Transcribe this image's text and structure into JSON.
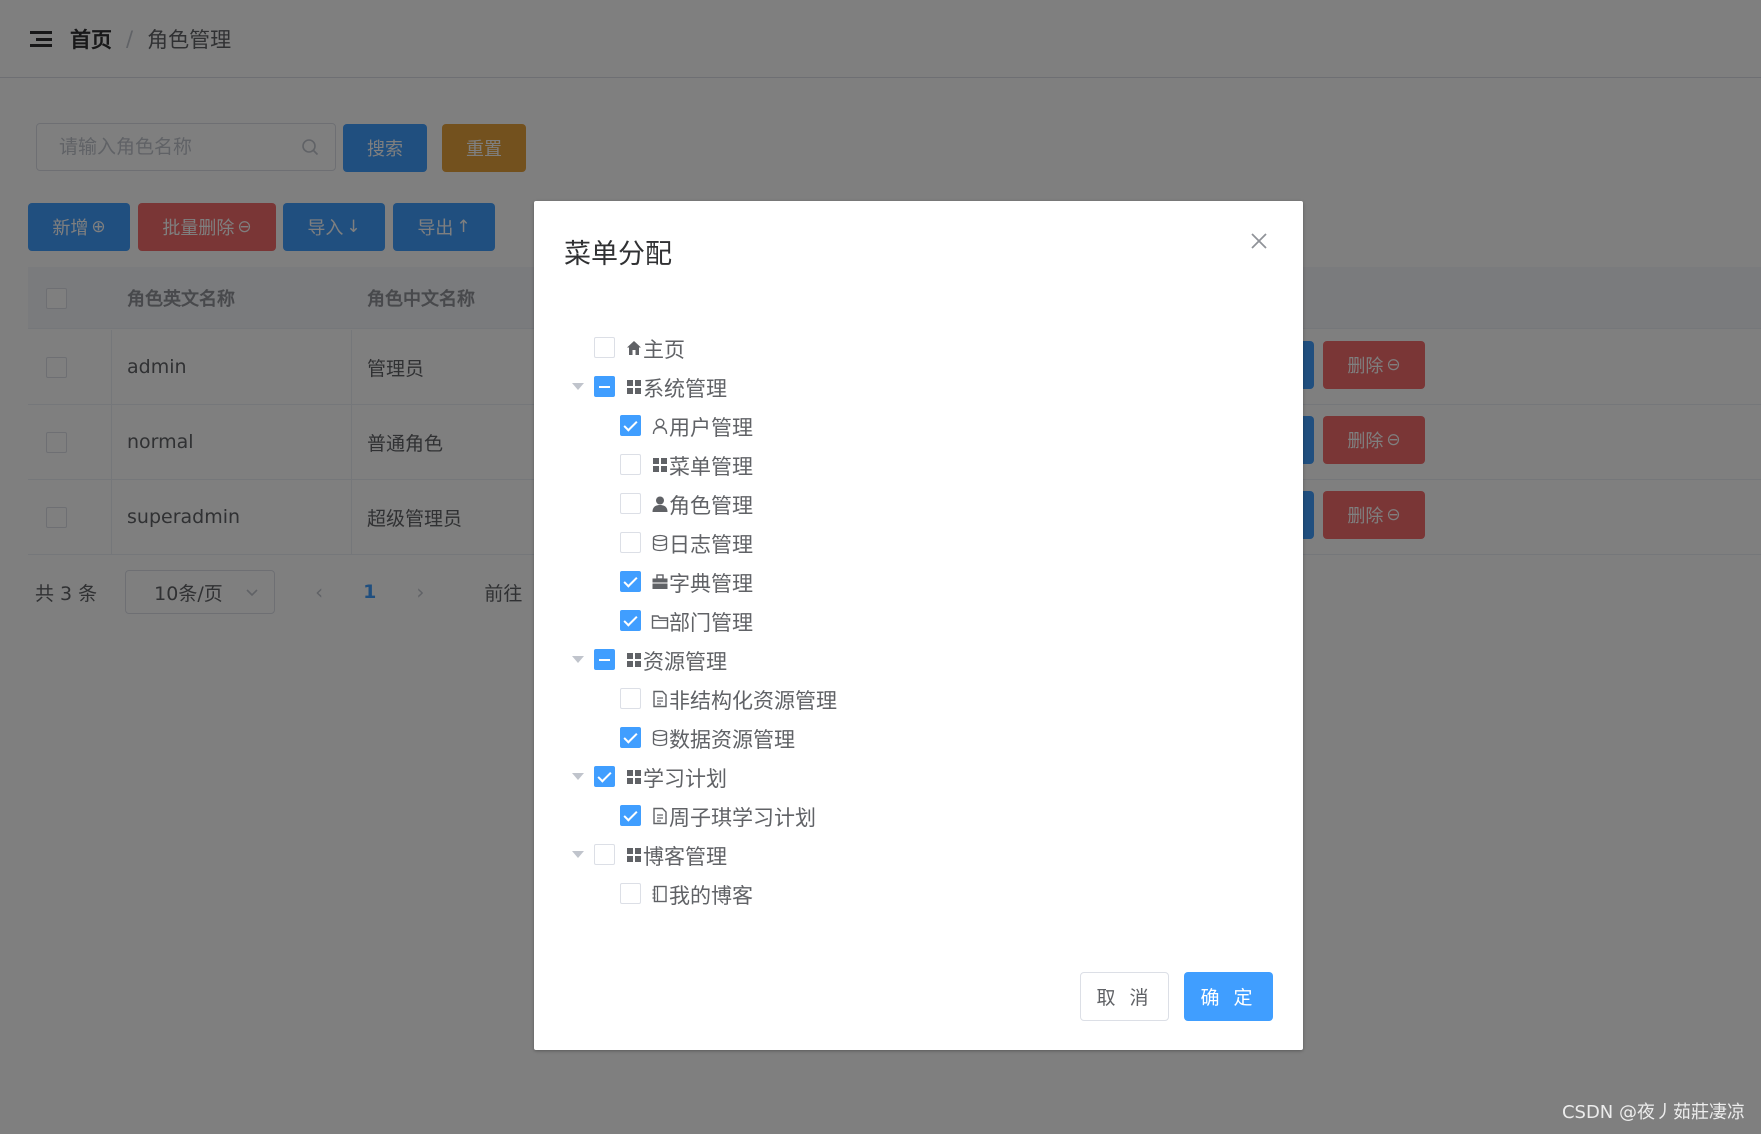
{
  "breadcrumb": {
    "home": "首页",
    "separator": "/",
    "current": "角色管理"
  },
  "search": {
    "placeholder": "请输入角色名称",
    "value": ""
  },
  "toolbar": {
    "search_label": "搜索",
    "reset_label": "重置",
    "add_label": "新增",
    "batch_delete_label": "批量删除",
    "import_label": "导入",
    "export_label": "导出"
  },
  "table": {
    "columns": [
      "角色英文名称",
      "角色中文名称"
    ],
    "rows": [
      {
        "en": "admin",
        "cn": "管理员"
      },
      {
        "en": "normal",
        "cn": "普通角色"
      },
      {
        "en": "superadmin",
        "cn": "超级管理员"
      }
    ],
    "delete_label": "删除"
  },
  "pagination": {
    "total": "共 3 条",
    "page_size": "10条/页",
    "current_page": "1",
    "goto": "前往"
  },
  "dialog": {
    "title": "菜单分配",
    "cancel_label": "取 消",
    "ok_label": "确 定",
    "tree": [
      {
        "label": "主页",
        "icon": "home-icon",
        "level": 0,
        "state": "unchecked"
      },
      {
        "label": "系统管理",
        "icon": "grid-icon",
        "level": 0,
        "state": "indeterminate",
        "expanded": true
      },
      {
        "label": "用户管理",
        "icon": "user-outline-icon",
        "level": 1,
        "state": "checked"
      },
      {
        "label": "菜单管理",
        "icon": "grid-icon",
        "level": 1,
        "state": "unchecked"
      },
      {
        "label": "角色管理",
        "icon": "user-solid-icon",
        "level": 1,
        "state": "unchecked"
      },
      {
        "label": "日志管理",
        "icon": "database-icon",
        "level": 1,
        "state": "unchecked"
      },
      {
        "label": "字典管理",
        "icon": "briefcase-icon",
        "level": 1,
        "state": "checked"
      },
      {
        "label": "部门管理",
        "icon": "folder-icon",
        "level": 1,
        "state": "checked"
      },
      {
        "label": "资源管理",
        "icon": "grid-icon",
        "level": 0,
        "state": "indeterminate",
        "expanded": true
      },
      {
        "label": "非结构化资源管理",
        "icon": "document-icon",
        "level": 1,
        "state": "unchecked"
      },
      {
        "label": "数据资源管理",
        "icon": "database-icon",
        "level": 1,
        "state": "checked"
      },
      {
        "label": "学习计划",
        "icon": "grid-icon",
        "level": 0,
        "state": "checked",
        "expanded": true
      },
      {
        "label": "周子琪学习计划",
        "icon": "document-icon",
        "level": 1,
        "state": "checked"
      },
      {
        "label": "博客管理",
        "icon": "grid-icon",
        "level": 0,
        "state": "unchecked",
        "expanded": true
      },
      {
        "label": "我的博客",
        "icon": "notebook-icon",
        "level": 1,
        "state": "unchecked"
      }
    ]
  },
  "watermark": "CSDN @夜丿茹莊凄凉",
  "colors": {
    "primary": "#409eff",
    "danger": "#f56c6c",
    "warning": "#e6a23c"
  }
}
